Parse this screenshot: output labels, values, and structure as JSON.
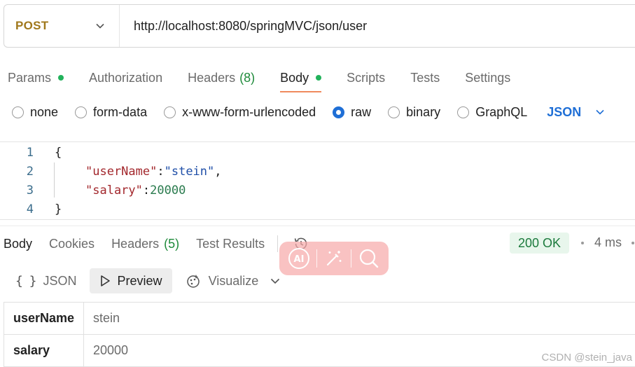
{
  "request": {
    "method": "POST",
    "url": "http://localhost:8080/springMVC/json/user"
  },
  "request_tabs": [
    {
      "label": "Params",
      "dot": true
    },
    {
      "label": "Authorization"
    },
    {
      "label": "Headers",
      "count": "(8)"
    },
    {
      "label": "Body",
      "dot": true,
      "active": true
    },
    {
      "label": "Scripts"
    },
    {
      "label": "Tests"
    },
    {
      "label": "Settings"
    }
  ],
  "body_types": {
    "options": [
      "none",
      "form-data",
      "x-www-form-urlencoded",
      "raw",
      "binary",
      "GraphQL"
    ],
    "selected": "raw",
    "language": "JSON"
  },
  "editor": {
    "line_numbers": [
      "1",
      "2",
      "3",
      "4"
    ],
    "lines": {
      "open": "{",
      "key1": "\"userName\"",
      "colon": ":",
      "val1": "\"stein\"",
      "comma": ",",
      "key2": "\"salary\"",
      "val2": "20000",
      "close": "}"
    }
  },
  "response_tabs": [
    {
      "label": "Body",
      "active": true
    },
    {
      "label": "Cookies"
    },
    {
      "label": "Headers",
      "count": "(5)"
    },
    {
      "label": "Test Results"
    }
  ],
  "response_status": {
    "code": "200 OK",
    "time": "4 ms"
  },
  "view_modes": {
    "json": "JSON",
    "preview": "Preview",
    "visualize": "Visualize"
  },
  "preview_table": [
    {
      "key": "userName",
      "value": "stein"
    },
    {
      "key": "salary",
      "value": "20000"
    }
  ],
  "watermark": "CSDN @stein_java",
  "colors": {
    "method": "#a0781c",
    "active_tab_underline": "#f08a5d",
    "dot_green": "#22b25b",
    "accent_blue": "#1f6fd6",
    "status_bg": "#e8f6ec",
    "status_text": "#1b7a3c"
  },
  "icons": {
    "method_chevron": "chevron-down-icon",
    "language_chevron": "chevron-down-icon",
    "history": "history-icon",
    "json_view": "braces-icon",
    "preview_view": "play-icon",
    "visualize_view": "visualize-icon",
    "ai_tool": "ai-icon",
    "magic_tool": "magic-wand-icon",
    "search_tool": "search-icon"
  }
}
